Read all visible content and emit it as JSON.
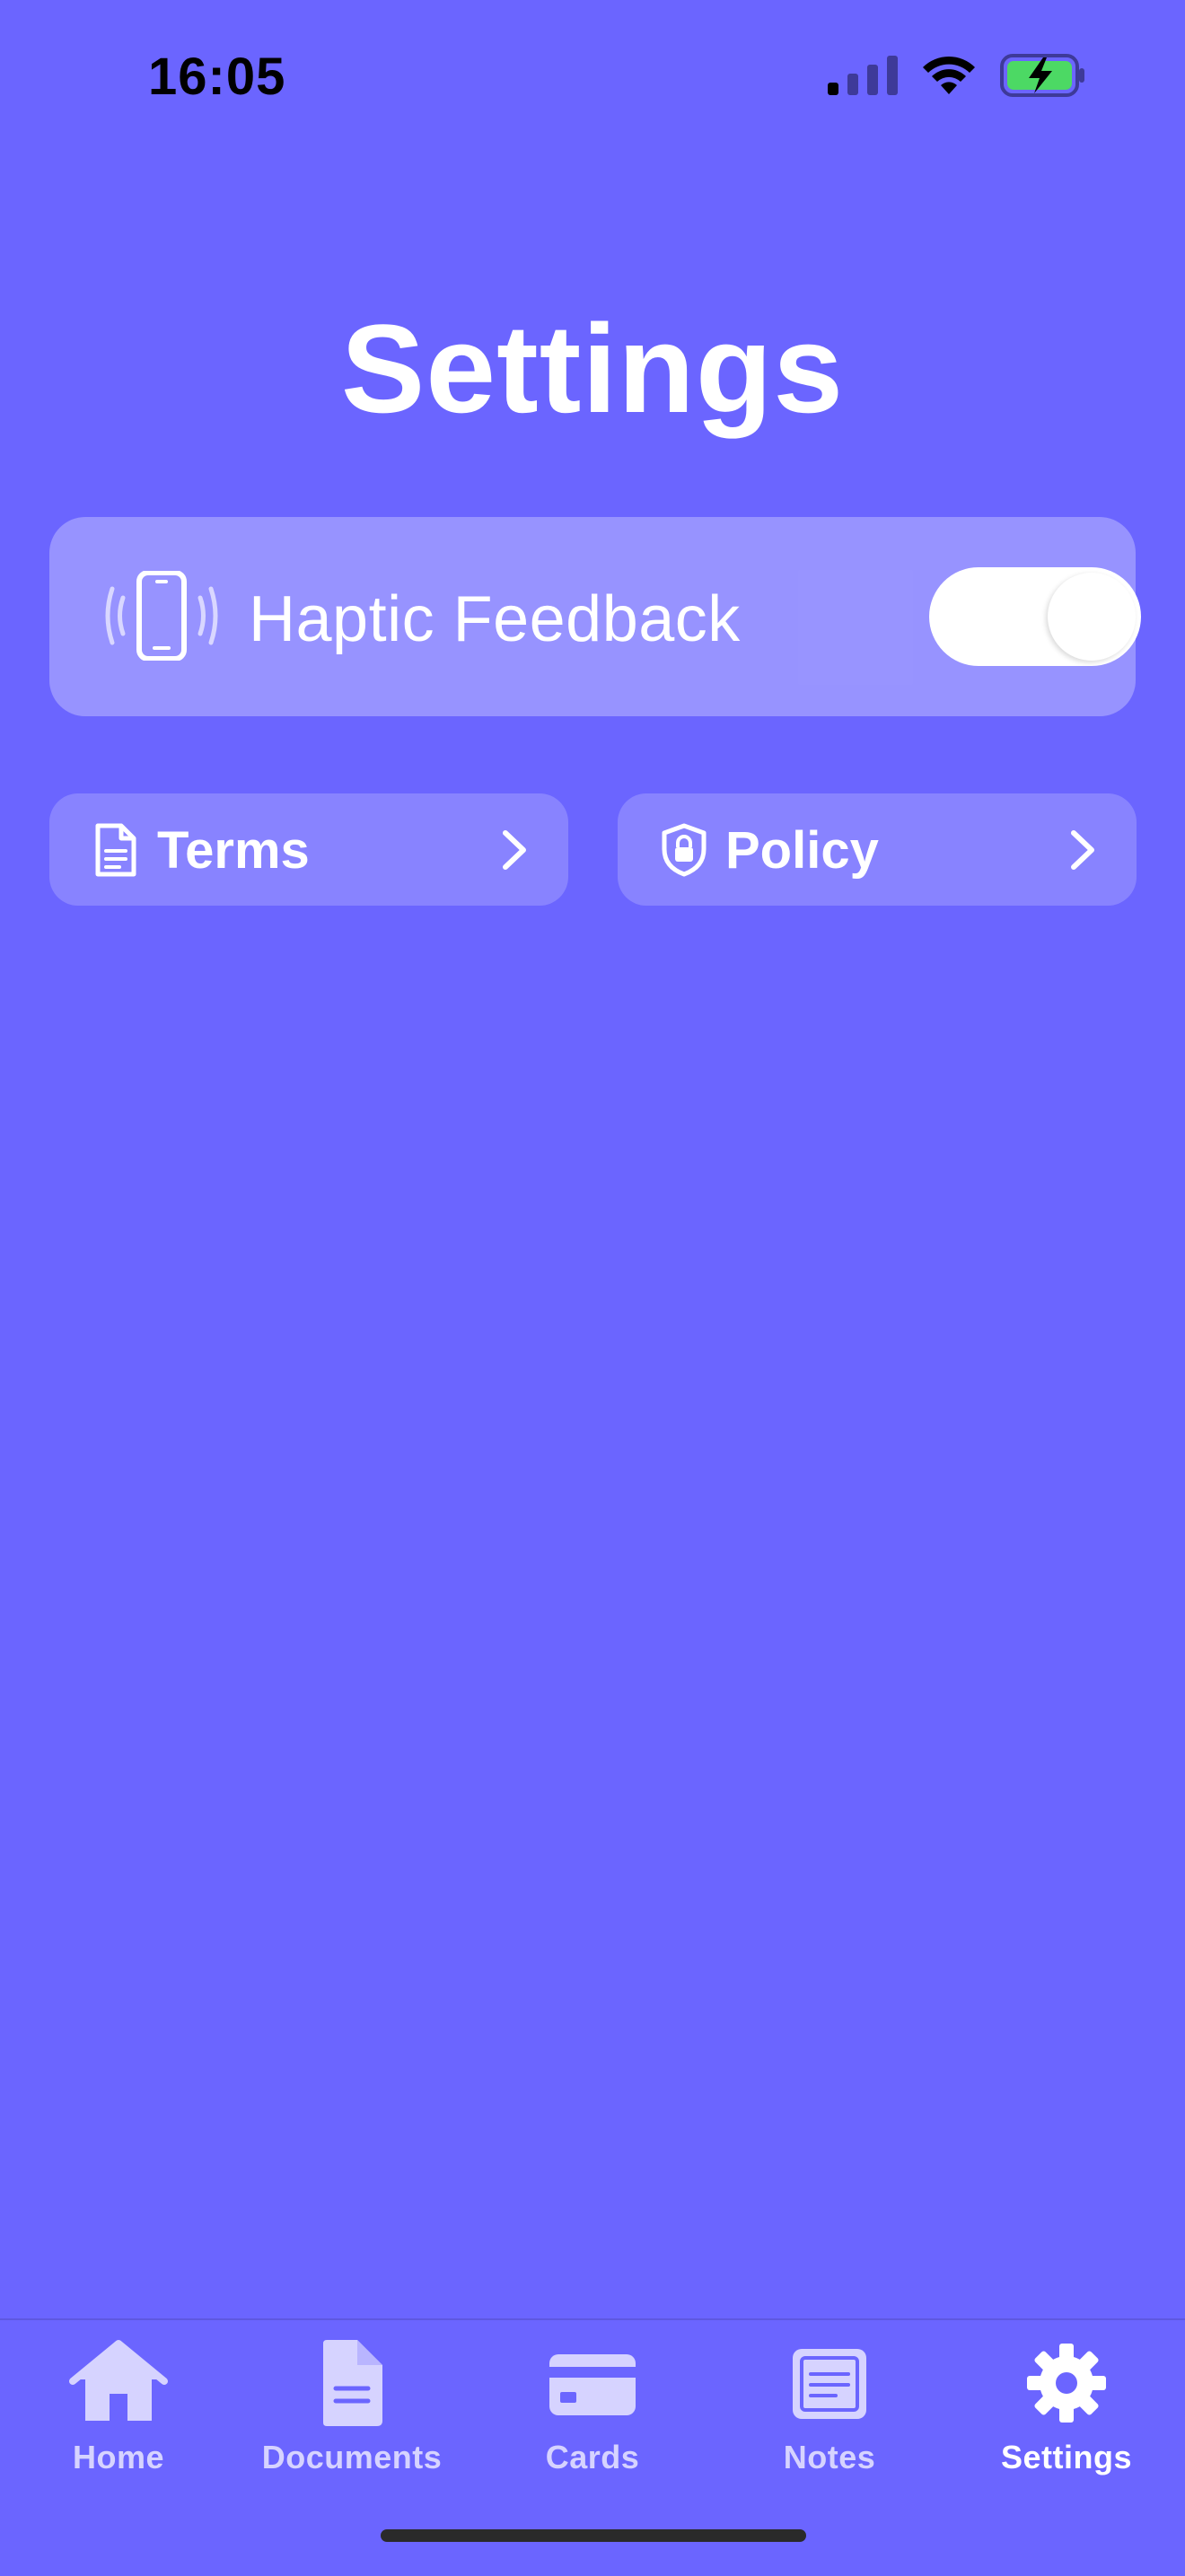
{
  "status": {
    "time": "16:05"
  },
  "page": {
    "title": "Settings"
  },
  "haptic": {
    "label": "Haptic Feedback",
    "enabled": true
  },
  "links": {
    "terms": "Terms",
    "policy": "Policy"
  },
  "tabs": [
    {
      "label": "Home",
      "icon": "house-icon",
      "active": false
    },
    {
      "label": "Documents",
      "icon": "document-icon",
      "active": false
    },
    {
      "label": "Cards",
      "icon": "credit-card-icon",
      "active": false
    },
    {
      "label": "Notes",
      "icon": "note-icon",
      "active": false
    },
    {
      "label": "Settings",
      "icon": "gear-icon",
      "active": true
    }
  ],
  "colors": {
    "background": "#6b65ff",
    "tab_inactive": "#d6d3ff",
    "battery_fill": "#4cd964"
  }
}
